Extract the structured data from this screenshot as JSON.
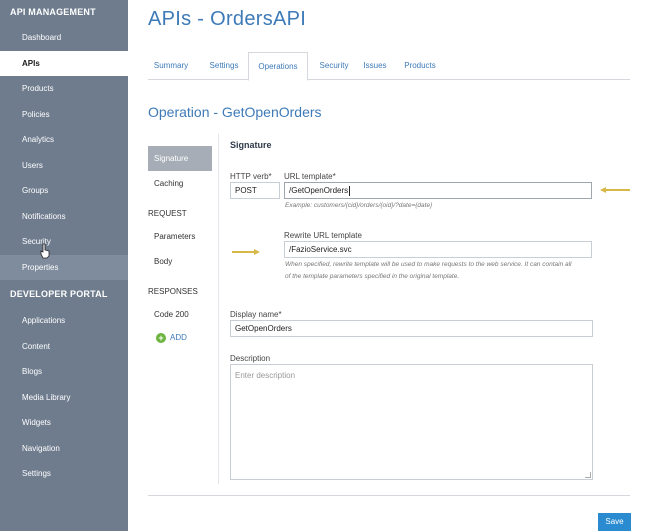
{
  "sidebar": {
    "section1": "API MANAGEMENT",
    "items1": [
      {
        "label": "Dashboard"
      },
      {
        "label": "APIs"
      },
      {
        "label": "Products"
      },
      {
        "label": "Policies"
      },
      {
        "label": "Analytics"
      },
      {
        "label": "Users"
      },
      {
        "label": "Groups"
      },
      {
        "label": "Notifications"
      },
      {
        "label": "Security"
      },
      {
        "label": "Properties"
      }
    ],
    "section2": "DEVELOPER PORTAL",
    "items2": [
      {
        "label": "Applications"
      },
      {
        "label": "Content"
      },
      {
        "label": "Blogs"
      },
      {
        "label": "Media Library"
      },
      {
        "label": "Widgets"
      },
      {
        "label": "Navigation"
      },
      {
        "label": "Settings"
      }
    ]
  },
  "header": {
    "title": "APIs - OrdersAPI"
  },
  "tabs": [
    {
      "label": "Summary"
    },
    {
      "label": "Settings"
    },
    {
      "label": "Operations"
    },
    {
      "label": "Security"
    },
    {
      "label": "Issues"
    },
    {
      "label": "Products"
    }
  ],
  "operation": {
    "title": "Operation - GetOpenOrders"
  },
  "mini_nav": {
    "signature": "Signature",
    "caching": "Caching",
    "request_head": "REQUEST",
    "parameters": "Parameters",
    "body": "Body",
    "responses_head": "RESPONSES",
    "code200": "Code 200",
    "add": "ADD"
  },
  "form": {
    "section_title": "Signature",
    "http_verb_label": "HTTP verb*",
    "http_verb_value": "POST",
    "url_template_label": "URL template*",
    "url_template_value": "/GetOpenOrders",
    "url_template_hint": "Example: customers/{cid}/orders/{oid}/?date={date}",
    "rewrite_label": "Rewrite URL template",
    "rewrite_value": "/FazioService.svc",
    "rewrite_hint_1": "When specified, rewrite template will be used to make requests to the web service. It can contain all",
    "rewrite_hint_2": "of the template parameters specified in the original template.",
    "display_name_label": "Display name*",
    "display_name_value": "GetOpenOrders",
    "description_label": "Description",
    "description_placeholder": "Enter description"
  },
  "actions": {
    "save": "Save"
  },
  "colors": {
    "sidebar": "#6e7c8e",
    "accent": "#3d7ab8",
    "arrow": "#d9b84a",
    "save": "#2b8bd1",
    "add": "#6cb33e"
  }
}
